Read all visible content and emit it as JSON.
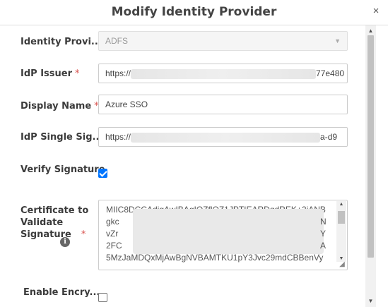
{
  "dialog": {
    "title": "Modify Identity Provider",
    "close_glyph": "×"
  },
  "form": {
    "identity_provider": {
      "label": "Identity Provi...",
      "value": "ADFS"
    },
    "idp_issuer": {
      "label": "IdP Issuer",
      "required": "*",
      "value_prefix": "https://",
      "value_suffix": "77e480"
    },
    "display_name": {
      "label": "Display Name",
      "required": "*",
      "value": "Azure SSO"
    },
    "idp_sso": {
      "label": "IdP Single Sig...",
      "value_prefix": "https://",
      "value_suffix": "a-d9"
    },
    "verify_signature": {
      "label": "Verify Signature",
      "checked": true
    },
    "certificate": {
      "label_line1": "Certificate to",
      "label_line2": "Validate",
      "label_line3": "Signature",
      "required": "*",
      "info_glyph": "i",
      "lines": [
        "MIIC8DCCAdigAwIBAgIQZflOZ1JPTIEARDqdREK+2jANB",
        "gkc",
        "vZr",
        "2FC",
        "5MzJaMDQxMjAwBgNVBAMTKU1pY3Jvc29mdCBBenVy"
      ],
      "right_chars": [
        "N",
        "Y",
        "A"
      ]
    },
    "enable_encryption": {
      "label": "Enable Encry...",
      "checked": false
    }
  },
  "colors": {
    "accent": "#0075ff",
    "required": "#d9534f"
  }
}
